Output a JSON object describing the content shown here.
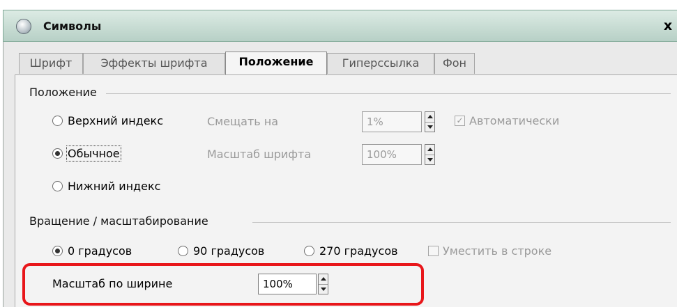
{
  "window": {
    "title": "Символы",
    "close_label": "x"
  },
  "tabs": [
    {
      "label": "Шрифт"
    },
    {
      "label": "Эффекты шрифта"
    },
    {
      "label": "Положение"
    },
    {
      "label": "Гиперссылка"
    },
    {
      "label": "Фон"
    }
  ],
  "active_tab": "Положение",
  "position_section": {
    "title": "Положение",
    "superscript": "Верхний индекс",
    "normal": "Обычное",
    "subscript": "Нижний индекс",
    "selected": "Обычное",
    "raise_by_label": "Смещать на",
    "raise_by_value": "1%",
    "font_scale_label": "Масштаб шрифта",
    "font_scale_value": "100%",
    "automatic_label": "Автоматически",
    "automatic_checked": true
  },
  "rotation_section": {
    "title": "Вращение / масштабирование",
    "deg0": "0 градусов",
    "deg90": "90 градусов",
    "deg270": "270 градусов",
    "selected": "0 градусов",
    "fit_to_line_label": "Уместить в строке",
    "fit_to_line_checked": false,
    "scale_width_label": "Масштаб по ширине",
    "scale_width_value": "100%"
  },
  "colors": {
    "highlight": "#e8161a",
    "titlebar": "#c6dbd2"
  }
}
